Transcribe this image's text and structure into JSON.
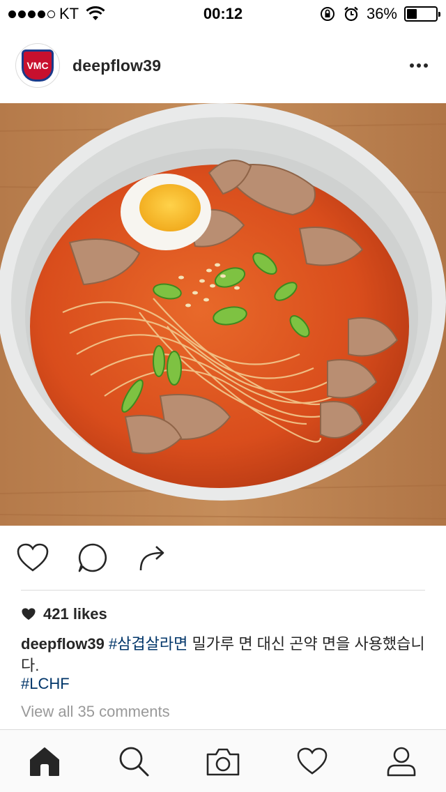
{
  "status_bar": {
    "carrier": "KT",
    "time": "00:12",
    "battery_percent": "36%",
    "battery_level": 0.36,
    "signal_bars_filled": 4,
    "signal_bars_total": 5
  },
  "post": {
    "username": "deepflow39",
    "avatar_text": "VMC",
    "likes": "421 likes",
    "caption": {
      "username": "deepflow39",
      "hashtag": "#삼겹살라면",
      "text": " 밀가루 면 대신 곤약 면을 사용했습니다.",
      "hashtag_line": "#LCHF"
    },
    "view_comments": "View all 35 comments"
  },
  "icons": {
    "more": "more-icon",
    "like": "heart-outline-icon",
    "comment": "comment-icon",
    "share": "share-icon",
    "likes": "heart-filled-icon",
    "home": "home-icon",
    "search": "search-icon",
    "camera": "camera-icon",
    "activity": "heart-outline-icon",
    "profile": "profile-icon"
  },
  "colors": {
    "hashtag": "#003569",
    "muted": "#999999",
    "text": "#262626"
  }
}
